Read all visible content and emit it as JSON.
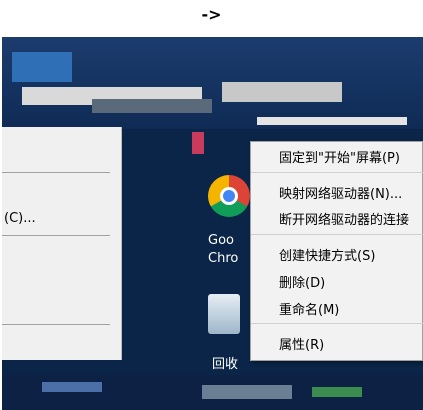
{
  "header": {
    "arrow": "->"
  },
  "left_menu": {
    "items": [
      {
        "label": "(C)..."
      }
    ]
  },
  "desktop": {
    "icons": [
      {
        "name": "chrome",
        "label_line1": "Goo",
        "label_line2": "Chro"
      },
      {
        "name": "recycle-bin",
        "label": "回收"
      }
    ]
  },
  "context_menu": {
    "items": [
      {
        "label": "固定到\"开始\"屏幕(P)"
      },
      {
        "label": "映射网络驱动器(N)..."
      },
      {
        "label": "断开网络驱动器的连接"
      },
      {
        "label": "创建快捷方式(S)"
      },
      {
        "label": "删除(D)"
      },
      {
        "label": "重命名(M)"
      },
      {
        "label": "属性(R)"
      }
    ]
  }
}
